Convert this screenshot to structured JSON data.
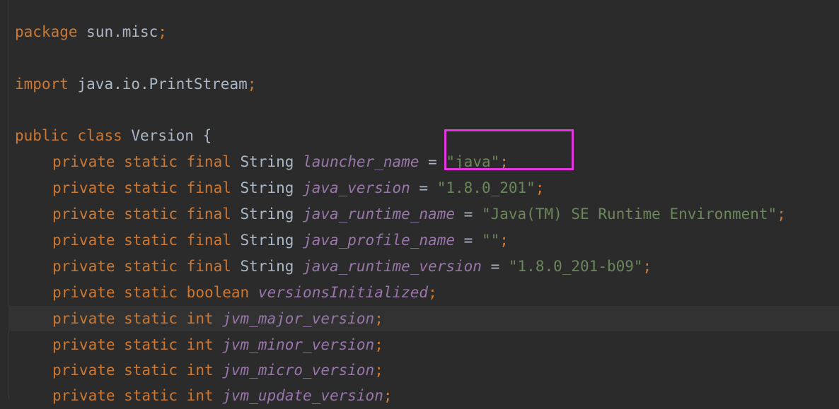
{
  "code": {
    "line1": {
      "keyword": "package",
      "name": "sun.misc",
      "semicolon": ";"
    },
    "line2": {
      "keyword": "import",
      "name": "java.io.PrintStream",
      "semicolon": ";"
    },
    "line3": {
      "kw_public": "public",
      "kw_class": "class",
      "class_name": "Version",
      "brace": "{"
    },
    "fields": [
      {
        "modifiers": "private static final",
        "type": "String",
        "name": "launcher_name",
        "eq": "=",
        "value": "\"java\"",
        "semicolon": ";"
      },
      {
        "modifiers": "private static final",
        "type": "String",
        "name": "java_version",
        "eq": "=",
        "value": "\"1.8.0_201\"",
        "semicolon": ";"
      },
      {
        "modifiers": "private static final",
        "type": "String",
        "name": "java_runtime_name",
        "eq": "=",
        "value": "\"Java(TM) SE Runtime Environment\"",
        "semicolon": ";"
      },
      {
        "modifiers": "private static final",
        "type": "String",
        "name": "java_profile_name",
        "eq": "=",
        "value": "\"\"",
        "semicolon": ";"
      },
      {
        "modifiers": "private static final",
        "type": "String",
        "name": "java_runtime_version",
        "eq": "=",
        "value": "\"1.8.0_201-b09\"",
        "semicolon": ";"
      },
      {
        "modifiers": "private static",
        "type": "boolean",
        "name": "versionsInitialized",
        "semicolon": ";"
      },
      {
        "modifiers": "private static",
        "type": "int",
        "name": "jvm_major_version",
        "semicolon": ";"
      },
      {
        "modifiers": "private static",
        "type": "int",
        "name": "jvm_minor_version",
        "semicolon": ";"
      },
      {
        "modifiers": "private static",
        "type": "int",
        "name": "jvm_micro_version",
        "semicolon": ";"
      },
      {
        "modifiers": "private static",
        "type": "int",
        "name": "jvm_update_version",
        "semicolon": ";"
      }
    ]
  },
  "colors": {
    "background": "#2b2b2b",
    "keyword": "#cc7832",
    "plain": "#a9b7c6",
    "field": "#9876aa",
    "string": "#6a8759",
    "highlight_box": "#e535e0",
    "current_line": "#323232"
  }
}
